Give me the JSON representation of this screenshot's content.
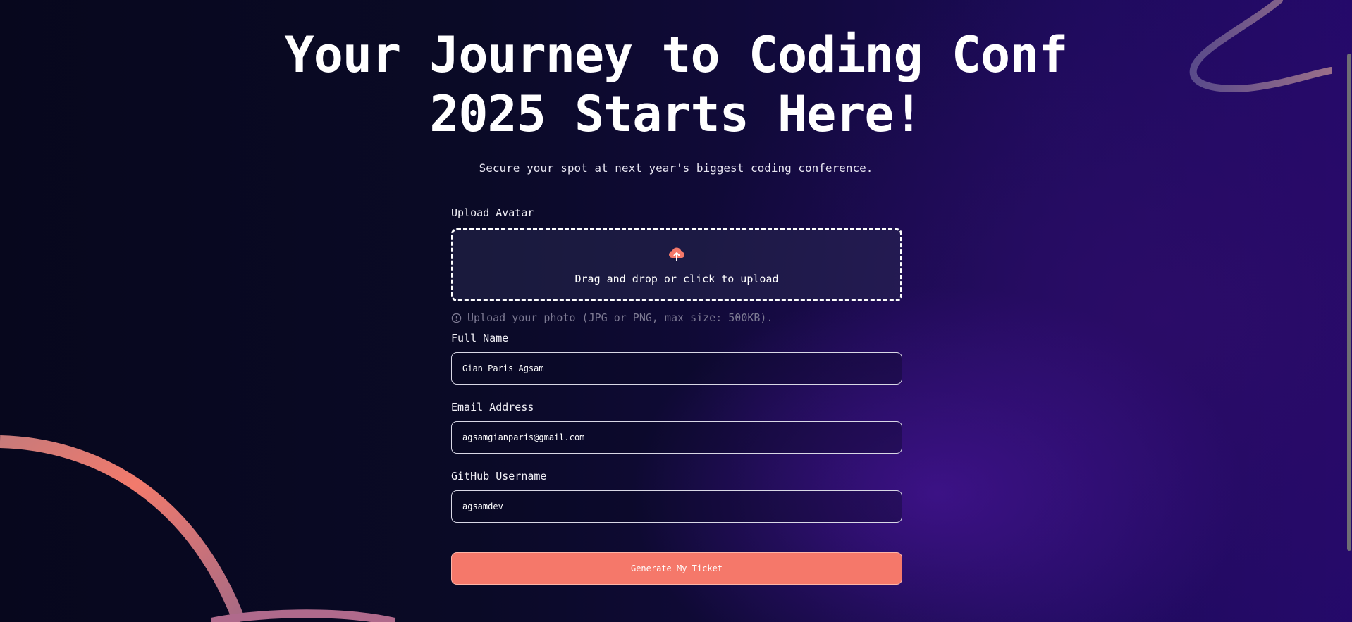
{
  "header": {
    "title": "Your Journey to Coding Conf 2025 Starts Here!",
    "subtitle": "Secure your spot at next year's biggest coding conference."
  },
  "form": {
    "avatar": {
      "label": "Upload Avatar",
      "drop_text": "Drag and drop or click to upload",
      "upload_icon": "cloud-upload-icon",
      "hint": "Upload your photo (JPG or PNG, max size: 500KB).",
      "hint_icon": "info-icon"
    },
    "full_name": {
      "label": "Full Name",
      "value": "Gian Paris Agsam"
    },
    "email": {
      "label": "Email Address",
      "value": "agsamgianparis@gmail.com"
    },
    "github": {
      "label": "GitHub Username",
      "value": "agsamdev"
    },
    "submit_label": "Generate My Ticket"
  },
  "colors": {
    "accent": "#f5786a",
    "background_dark": "#07071d",
    "background_purple": "#24096a",
    "hint_text": "#7d7a93"
  }
}
